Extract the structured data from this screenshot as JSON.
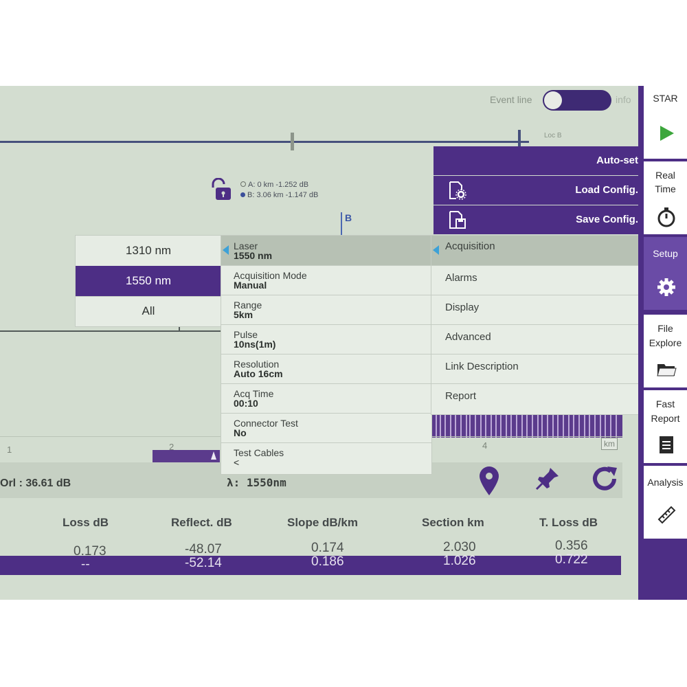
{
  "top_bar": {
    "event_line_label": "Event line",
    "toggle_info": "info",
    "loc_b_label": "Loc B"
  },
  "cursor_info": {
    "a_line": "A: 0 km -1.252 dB",
    "b_line": "B: 3.06 km -1.147 dB",
    "b_marker": "B"
  },
  "graph": {
    "axis_1": "1",
    "axis_2": "2",
    "axis_4": "4",
    "unit": "km"
  },
  "wavelength_menu": {
    "items": [
      {
        "label": "1310 nm",
        "selected": false
      },
      {
        "label": "1550 nm",
        "selected": true
      },
      {
        "label": "All",
        "selected": false
      }
    ]
  },
  "settings": {
    "items": [
      {
        "label": "Laser",
        "value": "1550 nm",
        "selected": true
      },
      {
        "label": "Acquisition Mode",
        "value": "Manual"
      },
      {
        "label": "Range",
        "value": "5km"
      },
      {
        "label": "Pulse",
        "value": "10ns(1m)"
      },
      {
        "label": "Resolution",
        "value": "Auto 16cm"
      },
      {
        "label": "Acq Time",
        "value": "00:10"
      },
      {
        "label": "Connector Test",
        "value": "No"
      },
      {
        "label": "Test Cables",
        "value": "<"
      }
    ]
  },
  "categories": {
    "items": [
      {
        "label": "Acquisition",
        "selected": true
      },
      {
        "label": "Alarms"
      },
      {
        "label": "Display"
      },
      {
        "label": "Advanced"
      },
      {
        "label": "Link Description"
      },
      {
        "label": "Report"
      }
    ]
  },
  "config": {
    "auto_set": "Auto-set",
    "load": "Load Config.",
    "save": "Save Config."
  },
  "info_line": {
    "orl": "Orl : 36.61 dB",
    "lambda": "λ: 1550nm"
  },
  "table": {
    "headers": [
      "Loss dB",
      "Reflect. dB",
      "Slope  dB/km",
      "Section km",
      "T. Loss dB"
    ],
    "rows": [
      [
        "0.173",
        "-48.07",
        "0.174",
        "2.030",
        "0.356"
      ],
      [
        "--",
        "-52.14",
        "0.186",
        "1.026",
        "0.722"
      ]
    ]
  },
  "sidebar": {
    "start": "STAR",
    "realtime_1": "Real",
    "realtime_2": "Time",
    "setup": "Setup",
    "file_1": "File",
    "file_2": "Explore",
    "fast_1": "Fast",
    "fast_2": "Report",
    "analysis": "Analysis"
  },
  "colors": {
    "accent": "#4d2e85",
    "screen_bg": "#d3ddd0",
    "selection_arrow": "#3da1d7"
  }
}
